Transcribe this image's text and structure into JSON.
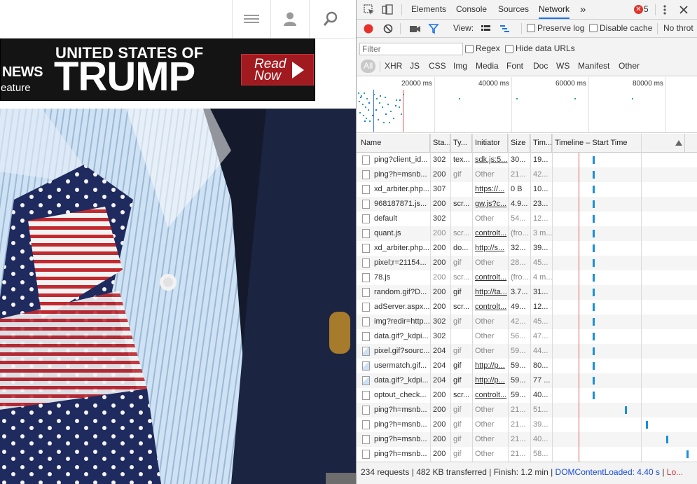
{
  "site": {
    "banner": {
      "news": "NEWS",
      "feature": "eature",
      "line1": "UNITED STATES OF",
      "line2": "TRUMP",
      "cta_line1": "Read",
      "cta_line2": "Now"
    },
    "hero_image": "necktie-elephant-pattern-photo",
    "icons": [
      "hamburger-menu-icon",
      "user-icon",
      "search-icon"
    ]
  },
  "devtools": {
    "tabs": [
      "Elements",
      "Console",
      "Sources",
      "Network"
    ],
    "active_tab": "Network",
    "more_tabs": "»",
    "error_count": "5",
    "toolbar": {
      "view_label": "View:",
      "preserve_log": "Preserve log",
      "disable_cache": "Disable cache",
      "throttling": "No throt"
    },
    "filter": {
      "placeholder": "Filter",
      "regex": "Regex",
      "hide_data_urls": "Hide data URLs",
      "types": [
        "All",
        "XHR",
        "JS",
        "CSS",
        "Img",
        "Media",
        "Font",
        "Doc",
        "WS",
        "Manifest",
        "Other"
      ],
      "active_type": "All"
    },
    "overview_ticks": [
      "20000 ms",
      "40000 ms",
      "60000 ms",
      "80000 ms"
    ],
    "columns": [
      "Name",
      "Sta...",
      "Ty...",
      "Initiator",
      "Size",
      "Tim...",
      "Timeline – Start Time"
    ],
    "rows": [
      {
        "name": "ping?client_id...",
        "status": "302",
        "type": "tex...",
        "initiator": "sdk.js:5...",
        "size": "30...",
        "time": "19...",
        "icon": "doc",
        "init_link": true,
        "wf": 0.12
      },
      {
        "name": "ping?h=msnb...",
        "status": "200",
        "type": "gif",
        "initiator": "Other",
        "size": "21...",
        "time": "42...",
        "icon": "doc",
        "init_link": false,
        "wf": 0.12
      },
      {
        "name": "xd_arbiter.php...",
        "status": "307",
        "type": "",
        "initiator": "https://...",
        "size": "0 B",
        "time": "10...",
        "icon": "doc",
        "init_link": true,
        "wf": 0.12
      },
      {
        "name": "968187871.js...",
        "status": "200",
        "type": "scr...",
        "initiator": "gw.js?c...",
        "size": "4.9...",
        "time": "23...",
        "icon": "doc",
        "init_link": true,
        "wf": 0.12
      },
      {
        "name": "default",
        "status": "302",
        "type": "",
        "initiator": "Other",
        "size": "54...",
        "time": "12...",
        "icon": "doc",
        "init_link": false,
        "wf": 0.12
      },
      {
        "name": "quant.js",
        "status": "200",
        "type": "scr...",
        "initiator": "controlt...",
        "size": "(fro...",
        "time": "3 m...",
        "icon": "doc",
        "init_link": true,
        "wf": 0.12,
        "cached": true
      },
      {
        "name": "xd_arbiter.php...",
        "status": "200",
        "type": "do...",
        "initiator": "http://s...",
        "size": "32...",
        "time": "39...",
        "icon": "doc",
        "init_link": true,
        "wf": 0.12
      },
      {
        "name": "pixel;r=21154...",
        "status": "200",
        "type": "gif",
        "initiator": "Other",
        "size": "28...",
        "time": "45...",
        "icon": "doc",
        "init_link": false,
        "wf": 0.12
      },
      {
        "name": "78.js",
        "status": "200",
        "type": "scr...",
        "initiator": "controlt...",
        "size": "(fro...",
        "time": "4 m...",
        "icon": "doc",
        "init_link": true,
        "wf": 0.12,
        "cached": true
      },
      {
        "name": "random.gif?D...",
        "status": "200",
        "type": "gif",
        "initiator": "http://ta...",
        "size": "3.7...",
        "time": "31...",
        "icon": "doc",
        "init_link": true,
        "wf": 0.12
      },
      {
        "name": "adServer.aspx...",
        "status": "200",
        "type": "scr...",
        "initiator": "controlt...",
        "size": "49...",
        "time": "12...",
        "icon": "doc",
        "init_link": true,
        "wf": 0.12
      },
      {
        "name": "img?redir=http...",
        "status": "302",
        "type": "gif",
        "initiator": "Other",
        "size": "42...",
        "time": "45...",
        "icon": "doc",
        "init_link": false,
        "wf": 0.12
      },
      {
        "name": "data.gif?_kdpi...",
        "status": "302",
        "type": "",
        "initiator": "Other",
        "size": "56...",
        "time": "47...",
        "icon": "doc",
        "init_link": false,
        "wf": 0.12
      },
      {
        "name": "pixel.gif?sourc...",
        "status": "204",
        "type": "gif",
        "initiator": "Other",
        "size": "59...",
        "time": "44...",
        "icon": "img",
        "init_link": false,
        "wf": 0.12
      },
      {
        "name": "usermatch.gif...",
        "status": "204",
        "type": "gif",
        "initiator": "http://p...",
        "size": "59...",
        "time": "80...",
        "icon": "img",
        "init_link": true,
        "wf": 0.12
      },
      {
        "name": "data.gif?_kdpi...",
        "status": "204",
        "type": "gif",
        "initiator": "http://p...",
        "size": "59...",
        "time": "77 ...",
        "icon": "img",
        "init_link": true,
        "wf": 0.12
      },
      {
        "name": "optout_check...",
        "status": "200",
        "type": "scr...",
        "initiator": "controlt...",
        "size": "59...",
        "time": "40...",
        "icon": "doc",
        "init_link": true,
        "wf": 0.12
      },
      {
        "name": "ping?h=msnb...",
        "status": "200",
        "type": "gif",
        "initiator": "Other",
        "size": "21...",
        "time": "51...",
        "icon": "doc",
        "init_link": false,
        "wf": 0.42
      },
      {
        "name": "ping?h=msnb...",
        "status": "200",
        "type": "gif",
        "initiator": "Other",
        "size": "21...",
        "time": "39...",
        "icon": "doc",
        "init_link": false,
        "wf": 0.61
      },
      {
        "name": "ping?h=msnb...",
        "status": "200",
        "type": "gif",
        "initiator": "Other",
        "size": "21...",
        "time": "40...",
        "icon": "doc",
        "init_link": false,
        "wf": 0.8
      },
      {
        "name": "ping?h=msnb...",
        "status": "200",
        "type": "gif",
        "initiator": "Other",
        "size": "21...",
        "time": "58...",
        "icon": "doc",
        "init_link": false,
        "wf": 0.99
      }
    ],
    "status_bar": {
      "requests": "234 requests",
      "transferred": "482 KB transferred",
      "finish": "Finish: 1.2 min",
      "dom_loaded": "DOMContentLoaded: 4.40 s",
      "load": "Lo..."
    },
    "colors": {
      "accent": "#1a73e8",
      "record": "#e8302a",
      "waterfall": "#1a8fd6"
    }
  }
}
